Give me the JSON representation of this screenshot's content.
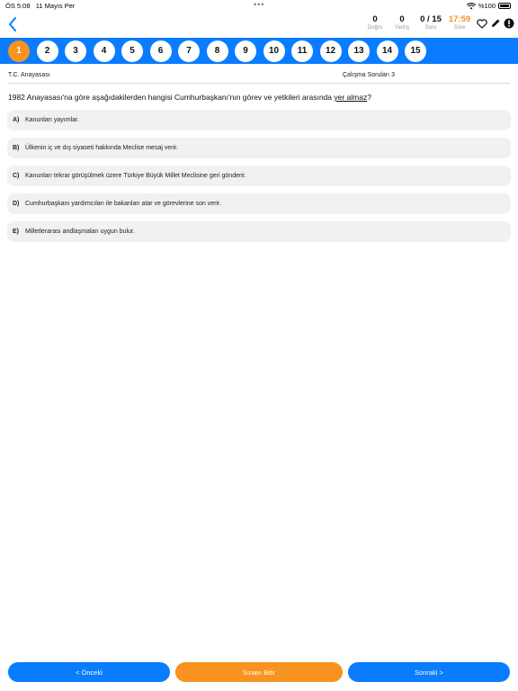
{
  "status_bar": {
    "time": "ÖS 5:08",
    "date": "11 Mayıs Per",
    "battery": "%100"
  },
  "stats": [
    {
      "value": "0",
      "label": "Doğru"
    },
    {
      "value": "0",
      "label": "Yanlış"
    },
    {
      "value": "0 / 15",
      "label": "Soru"
    },
    {
      "value": "17:59",
      "label": "Süre"
    }
  ],
  "question_numbers": [
    "1",
    "2",
    "3",
    "4",
    "5",
    "6",
    "7",
    "8",
    "9",
    "10",
    "11",
    "12",
    "13",
    "14",
    "15"
  ],
  "current_question": 1,
  "meta": {
    "subject": "T.C. Anayasası",
    "set": "Çalışma Soruları 3"
  },
  "question": {
    "text_before": "1982 Anayasası'na göre aşağıdakilerden hangisi Cumhurbaşkanı'nın görev ve yetkileri arasında ",
    "underlined": "yer almaz",
    "text_after": "?"
  },
  "options": [
    {
      "letter": "A)",
      "text": "Kanunları yayımlar."
    },
    {
      "letter": "B)",
      "text": "Ülkenin iç ve dış siyaseti hakkında Meclise mesaj verir."
    },
    {
      "letter": "C)",
      "text": "Kanunları tekrar görüşülmek üzere Türkiye Büyük Millet Meclisine geri gönderir."
    },
    {
      "letter": "D)",
      "text": "Cumhurbaşkanı yardımcıları ile bakanları atar ve görevlerine son verir."
    },
    {
      "letter": "E)",
      "text": "Milletlerarası andlaşmaları uygun bulur."
    }
  ],
  "buttons": {
    "prev": "< Önceki",
    "finish": "Sınavı Bitir",
    "next": "Sonraki >"
  },
  "colors": {
    "accent": "#0a7cff",
    "orange": "#f7931e"
  },
  "icons": {
    "back": "chevron-left-icon",
    "favorite": "heart-icon",
    "edit": "pencil-icon",
    "report": "alert-icon"
  }
}
